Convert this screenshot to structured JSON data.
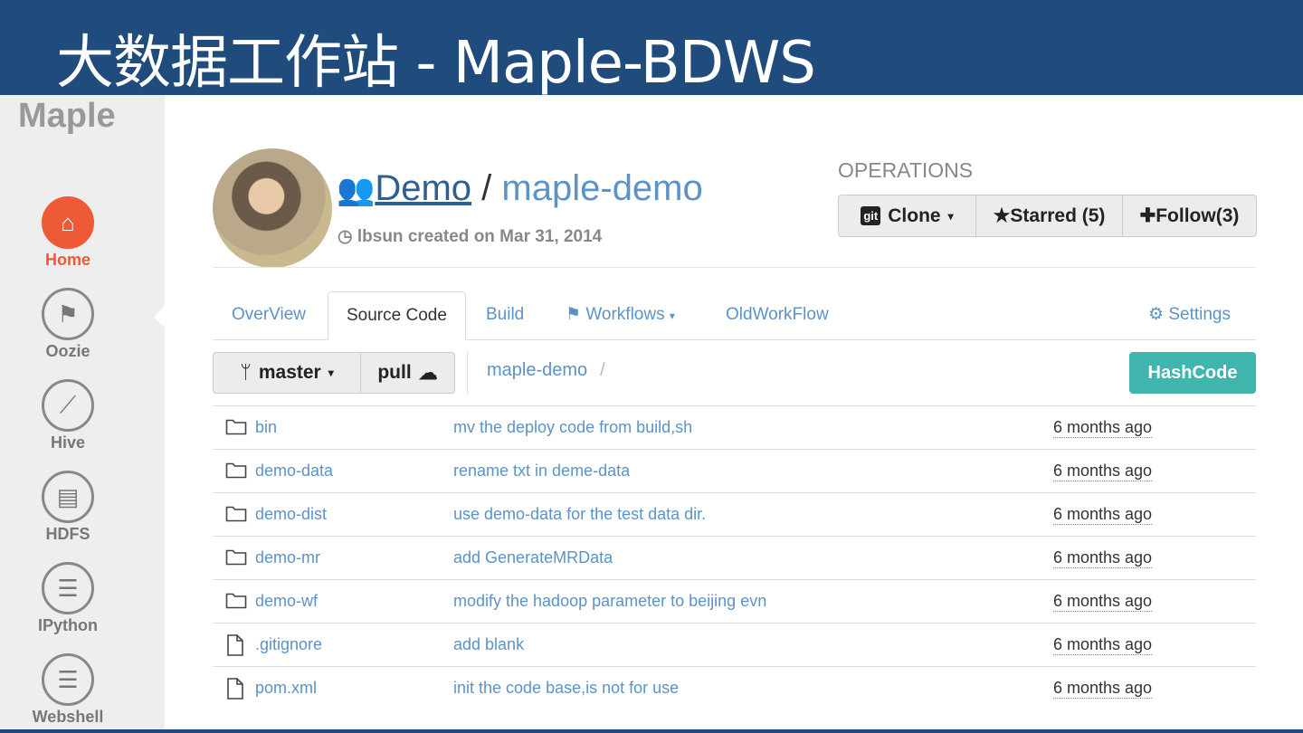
{
  "slide_title": "大数据工作站 - Maple-BDWS",
  "sidebar": {
    "brand": "Maple",
    "items": [
      {
        "label": "Home",
        "icon": "home-icon"
      },
      {
        "label": "Oozie",
        "icon": "flag-icon"
      },
      {
        "label": "Hive",
        "icon": "magic-wand-icon"
      },
      {
        "label": "HDFS",
        "icon": "file-icon"
      },
      {
        "label": "IPython",
        "icon": "server-icon"
      },
      {
        "label": "Webshell",
        "icon": "server-icon"
      }
    ]
  },
  "repo": {
    "owner": "Demo",
    "sep": "/",
    "name": "maple-demo",
    "meta": "lbsun created on Mar 31, 2014"
  },
  "operations": {
    "title": "OPERATIONS",
    "clone": "Clone",
    "starred": "Starred (5)",
    "follow": "Follow(3)"
  },
  "tabs": [
    {
      "label": "OverView"
    },
    {
      "label": "Source Code"
    },
    {
      "label": "Build"
    },
    {
      "label": "Workflows"
    },
    {
      "label": "OldWorkFlow"
    },
    {
      "label": "Settings"
    }
  ],
  "toolbar": {
    "branch": "master",
    "pull": "pull",
    "path": "maple-demo",
    "path_sep": "/",
    "hash": "HashCode"
  },
  "files": [
    {
      "name": "bin",
      "type": "folder",
      "message": "mv the deploy code from build,sh",
      "age": "6 months ago"
    },
    {
      "name": "demo-data",
      "type": "folder",
      "message": "rename txt in deme-data",
      "age": "6 months ago"
    },
    {
      "name": "demo-dist",
      "type": "folder",
      "message": "use demo-data for the test data dir.",
      "age": "6 months ago"
    },
    {
      "name": "demo-mr",
      "type": "folder",
      "message": "add GenerateMRData",
      "age": "6 months ago"
    },
    {
      "name": "demo-wf",
      "type": "folder",
      "message": "modify the hadoop parameter to beijing evn",
      "age": "6 months ago"
    },
    {
      "name": ".gitignore",
      "type": "file",
      "message": "add blank",
      "age": "6 months ago"
    },
    {
      "name": "pom.xml",
      "type": "file",
      "message": "init the code base,is not for use",
      "age": "6 months ago"
    }
  ]
}
